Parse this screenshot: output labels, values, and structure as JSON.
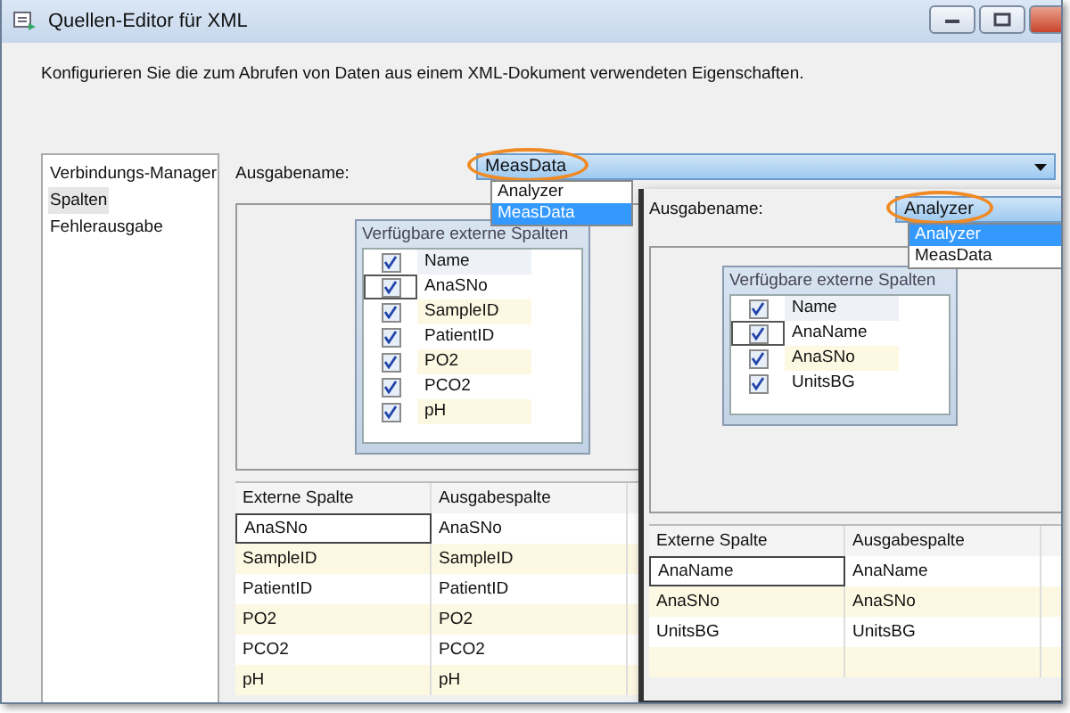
{
  "window": {
    "title": "Quellen-Editor für XML"
  },
  "description": "Konfigurieren Sie die zum Abrufen von Daten aus einem XML-Dokument verwendeten Eigenschaften.",
  "sidebar": {
    "items": [
      {
        "label": "Verbindungs-Manager",
        "selected": false
      },
      {
        "label": "Spalten",
        "selected": true
      },
      {
        "label": "Fehlerausgabe",
        "selected": false
      }
    ]
  },
  "main": {
    "output_label": "Ausgabename:",
    "output_value": "MeasData",
    "options": [
      {
        "label": "Analyzer",
        "selected": false
      },
      {
        "label": "MeasData",
        "selected": true
      }
    ],
    "available_columns": {
      "title": "Verfügbare externe Spalten",
      "header": "Name",
      "header_checked": true,
      "rows": [
        {
          "name": "AnaSNo",
          "checked": true
        },
        {
          "name": "SampleID",
          "checked": true
        },
        {
          "name": "PatientID",
          "checked": true
        },
        {
          "name": "PO2",
          "checked": true
        },
        {
          "name": "PCO2",
          "checked": true
        },
        {
          "name": "pH",
          "checked": true
        }
      ]
    },
    "mapping": {
      "columns": [
        "Externe Spalte",
        "Ausgabespalte"
      ],
      "rows": [
        [
          "AnaSNo",
          "AnaSNo"
        ],
        [
          "SampleID",
          "SampleID"
        ],
        [
          "PatientID",
          "PatientID"
        ],
        [
          "PO2",
          "PO2"
        ],
        [
          "PCO2",
          "PCO2"
        ],
        [
          "pH",
          "pH"
        ]
      ]
    }
  },
  "inset": {
    "output_label": "Ausgabename:",
    "output_value": "Analyzer",
    "options": [
      {
        "label": "Analyzer",
        "selected": true
      },
      {
        "label": "MeasData",
        "selected": false
      }
    ],
    "available_columns": {
      "title": "Verfügbare externe Spalten",
      "header": "Name",
      "header_checked": true,
      "rows": [
        {
          "name": "AnaName",
          "checked": true
        },
        {
          "name": "AnaSNo",
          "checked": true
        },
        {
          "name": "UnitsBG",
          "checked": true
        }
      ]
    },
    "mapping": {
      "columns": [
        "Externe Spalte",
        "Ausgabespalte"
      ],
      "rows": [
        [
          "AnaName",
          "AnaName"
        ],
        [
          "AnaSNo",
          "AnaSNo"
        ],
        [
          "UnitsBG",
          "UnitsBG"
        ],
        [
          "",
          ""
        ]
      ]
    }
  }
}
